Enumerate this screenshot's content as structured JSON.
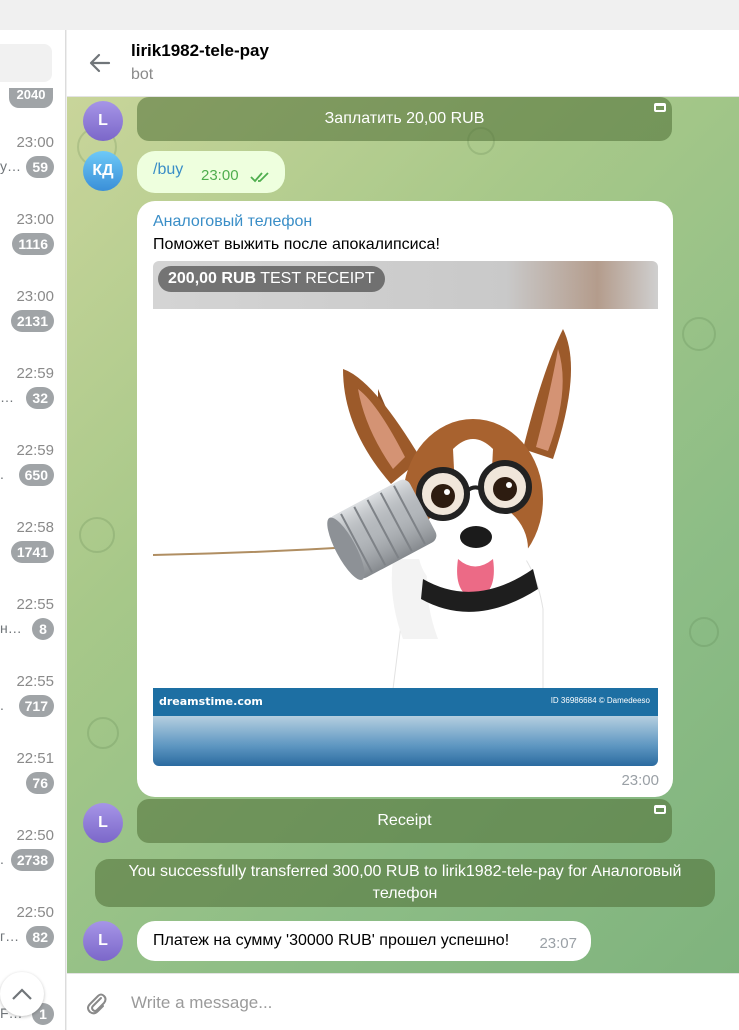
{
  "header": {
    "title": "lirik1982-tele-pay",
    "subtitle": "bot"
  },
  "chat_list": {
    "top_badge": "2040",
    "rows": [
      {
        "time": "23:00",
        "snippet": "y…",
        "badge": "59"
      },
      {
        "time": "23:00",
        "snippet": "",
        "badge": "1116"
      },
      {
        "time": "23:00",
        "snippet": "",
        "badge": "2131"
      },
      {
        "time": "22:59",
        "snippet": "…",
        "badge": "32"
      },
      {
        "time": "22:59",
        "snippet": ".",
        "badge": "650"
      },
      {
        "time": "22:58",
        "snippet": "",
        "badge": "1741"
      },
      {
        "time": "22:55",
        "snippet": "н…",
        "badge": "8"
      },
      {
        "time": "22:55",
        "snippet": ".",
        "badge": "717"
      },
      {
        "time": "22:51",
        "snippet": "",
        "badge": "76"
      },
      {
        "time": "22:50",
        "snippet": ".",
        "badge": "2738"
      },
      {
        "time": "22:50",
        "snippet": "г…",
        "badge": "82"
      },
      {
        "time": "",
        "snippet": "F…",
        "badge": "1"
      }
    ]
  },
  "messages": {
    "pay_button": "Заплатить 20,00 RUB",
    "user_avatar": "КД",
    "bot_avatar": "L",
    "buy_text": "/buy",
    "buy_time": "23:00",
    "invoice": {
      "title": "Аналоговый телефон",
      "description": "Поможет выжить после апокалипсиса!",
      "price": "200,00 RUB",
      "price_suffix": "TEST RECEIPT",
      "watermark_brand": "dreamstime.com",
      "watermark_id": "ID 36986684 © Damedeeso",
      "time": "23:00"
    },
    "receipt_button": "Receipt",
    "service_text": "You successfully transferred 300,00 RUB to lirik1982-tele-pay for Аналоговый телефон",
    "last_text": "Платеж на сумму '30000 RUB' прошел успешно!",
    "last_time": "23:07"
  },
  "composer": {
    "placeholder": "Write a message..."
  },
  "colors": {
    "outgoing_bubble": "#eeffde",
    "accent": "#3a8ec7",
    "chat_bg": "#a7c889"
  }
}
